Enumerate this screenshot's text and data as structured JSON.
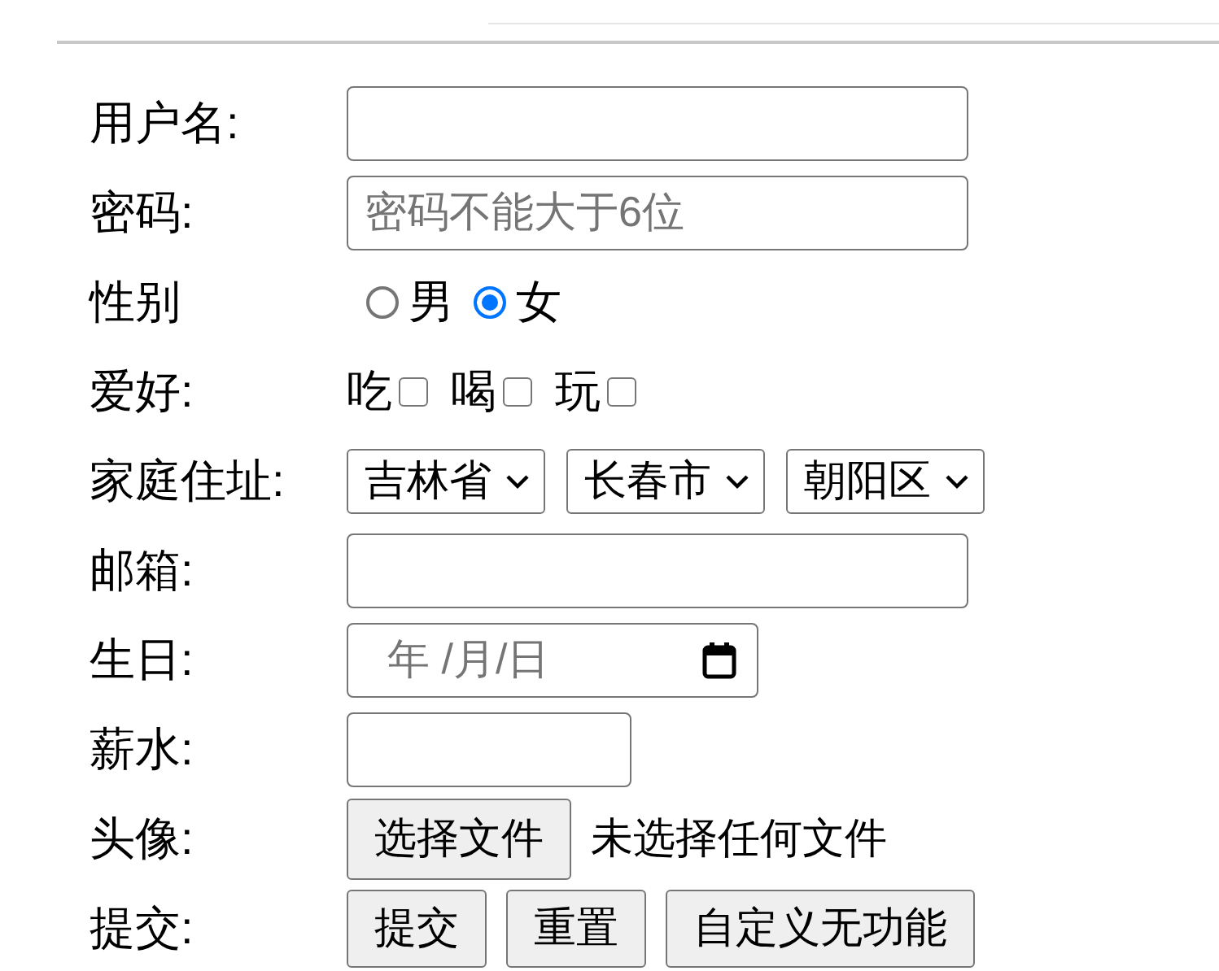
{
  "form": {
    "rows": [
      {
        "kind": "text",
        "label": "用户名:"
      },
      {
        "kind": "password",
        "label": "密码:",
        "placeholder": "密码不能大于6位"
      },
      {
        "kind": "radio",
        "label": "性别",
        "options": [
          {
            "label": "男",
            "selected": false
          },
          {
            "label": "女",
            "selected": true
          }
        ]
      },
      {
        "kind": "checkbox",
        "label": "爱好:",
        "options": [
          {
            "label": "吃",
            "checked": false
          },
          {
            "label": "喝",
            "checked": false
          },
          {
            "label": "玩",
            "checked": false
          }
        ]
      },
      {
        "kind": "select",
        "label": "家庭住址:",
        "selects": [
          "吉林省",
          "长春市",
          "朝阳区"
        ]
      },
      {
        "kind": "email",
        "label": "邮箱:"
      },
      {
        "kind": "date",
        "label": "生日:",
        "placeholder": "年 /月/日"
      },
      {
        "kind": "number",
        "label": "薪水:"
      },
      {
        "kind": "file",
        "label": "头像:",
        "button": "选择文件",
        "status": "未选择任何文件"
      },
      {
        "kind": "buttons",
        "label": "提交:",
        "buttons": [
          "提交",
          "重置",
          "自定义无功能"
        ]
      }
    ]
  }
}
